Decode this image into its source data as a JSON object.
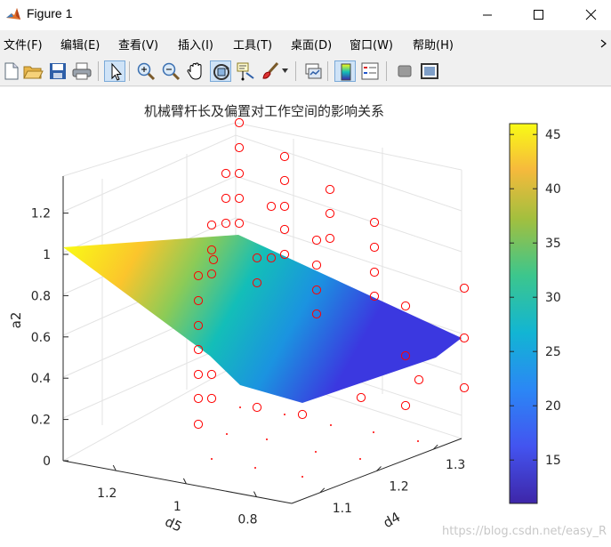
{
  "window": {
    "title": "Figure 1"
  },
  "menu": [
    "文件(F)",
    "编辑(E)",
    "查看(V)",
    "插入(I)",
    "工具(T)",
    "桌面(D)",
    "窗口(W)",
    "帮助(H)"
  ],
  "toolbar": [
    {
      "name": "new-figure",
      "icon": "new-file-icon"
    },
    {
      "name": "open-file",
      "icon": "folder-open-icon"
    },
    {
      "name": "save-figure",
      "icon": "save-icon"
    },
    {
      "name": "print-figure",
      "icon": "printer-icon"
    },
    {
      "name": "edit-plot",
      "icon": "pointer-arrow-icon"
    },
    {
      "name": "zoom-in",
      "icon": "zoom-in-icon"
    },
    {
      "name": "zoom-out",
      "icon": "zoom-out-icon"
    },
    {
      "name": "pan",
      "icon": "hand-icon"
    },
    {
      "name": "rotate-3d",
      "icon": "rotate-3d-icon"
    },
    {
      "name": "data-cursor",
      "icon": "data-cursor-icon"
    },
    {
      "name": "brush",
      "icon": "brush-icon"
    },
    {
      "name": "link-plot",
      "icon": "link-plot-icon"
    },
    {
      "name": "insert-colorbar",
      "icon": "colorbar-icon"
    },
    {
      "name": "insert-legend",
      "icon": "legend-icon"
    },
    {
      "name": "hide-plot-tools",
      "icon": "hide-tools-icon"
    },
    {
      "name": "show-plot-tools",
      "icon": "show-tools-icon"
    }
  ],
  "chart_data": {
    "type": "scatter",
    "title": "机械臂杆长及偏置对工作空间的影响关系",
    "xlabel": "d4",
    "ylabel": "d5",
    "zlabel": "a2",
    "x_ticks": [
      "1.1",
      "1.2",
      "1.3"
    ],
    "y_ticks": [
      "0.8",
      "1",
      "1.2"
    ],
    "z_ticks": [
      "0",
      "0.2",
      "0.4",
      "0.6",
      "0.8",
      "1",
      "1.2"
    ],
    "xlim": [
      1.05,
      1.35
    ],
    "ylim": [
      0.7,
      1.35
    ],
    "zlim": [
      0,
      1.35
    ],
    "grid": true,
    "marker": "open red circles",
    "marker_color": "#ff0000",
    "surface": {
      "description": "interpolated surface colored by workspace value",
      "vertices": [
        {
          "x": 1.05,
          "y": 1.35,
          "z": 1.02,
          "c": 46
        },
        {
          "x": 1.05,
          "y": 1.0,
          "z": 1.08,
          "c": 43
        },
        {
          "x": 1.35,
          "y": 0.7,
          "z": 0.6,
          "c": 20
        },
        {
          "x": 1.25,
          "y": 0.7,
          "z": 0.4,
          "c": 14
        },
        {
          "x": 1.1,
          "y": 0.8,
          "z": 0.3,
          "c": 11
        },
        {
          "x": 1.05,
          "y": 1.05,
          "z": 0.45,
          "c": 16
        }
      ]
    },
    "colorbar": {
      "ticks": [
        "15",
        "20",
        "25",
        "30",
        "35",
        "40",
        "45"
      ],
      "range": [
        11,
        46
      ],
      "colormap": "parula"
    }
  },
  "watermark": "https://blog.csdn.net/easy_R"
}
